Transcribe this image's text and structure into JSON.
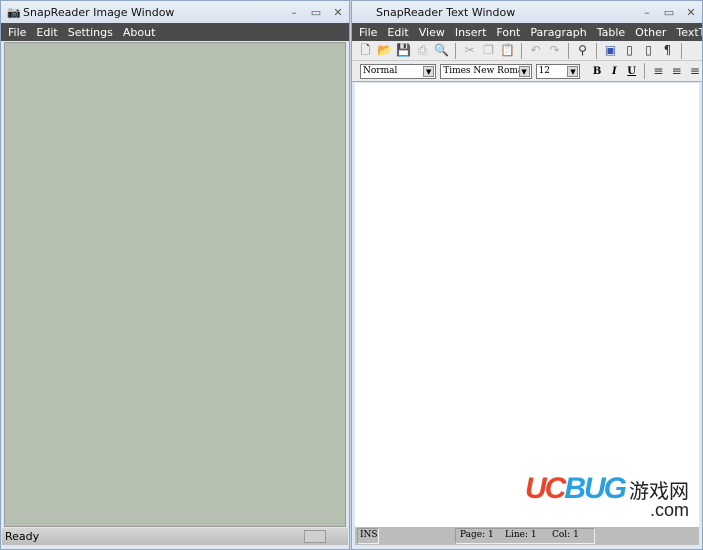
{
  "image_window": {
    "title": "SnapReader Image Window",
    "menu": [
      "File",
      "Edit",
      "Settings",
      "About"
    ],
    "status": "Ready",
    "background_color": "#b5c0b0"
  },
  "text_window": {
    "title": "SnapReader Text Window",
    "menu": [
      "File",
      "Edit",
      "View",
      "Insert",
      "Font",
      "Paragraph",
      "Table",
      "Other",
      "TextToSp"
    ],
    "toolbar_icons": [
      "new-icon",
      "open-icon",
      "save-icon",
      "print-icon",
      "print-preview-icon",
      "cut-icon",
      "copy-icon",
      "paste-icon",
      "undo-icon",
      "redo-icon",
      "find-icon",
      "insert-object-icon",
      "page-icon",
      "page-number-icon",
      "pilcrow-icon"
    ],
    "style": "Normal",
    "font": "Times New Roman",
    "size": "12",
    "bold": "B",
    "italic": "I",
    "underline": "U",
    "status": {
      "mode": "INS",
      "page": "Page: 1",
      "line": "Line: 1",
      "col": "Col: 1"
    }
  },
  "watermark": {
    "logo": "UCBUG",
    "cn": "游戏网",
    "suffix": ".com"
  }
}
